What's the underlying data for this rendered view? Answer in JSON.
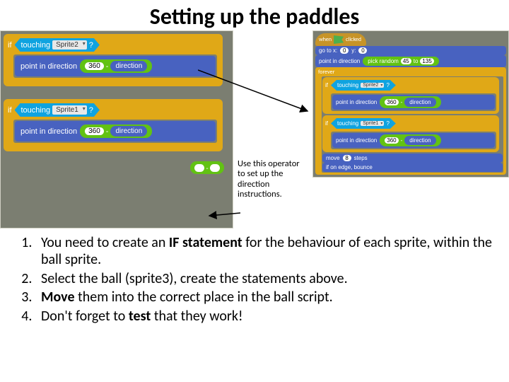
{
  "title": "Setting up the paddles",
  "left_blocks": {
    "if_label": "if",
    "touching_label": "touching",
    "sprite2": "Sprite2",
    "sprite1": "Sprite1",
    "qmark": "?",
    "point_dir": "point in direction",
    "val360": "360",
    "minus": "-",
    "direction": "direction"
  },
  "callout": "Use this operator to set up the direction instructions.",
  "right_blocks": {
    "when": "when",
    "clicked": "clicked",
    "goto": "go to x:",
    "y_label": "y:",
    "zero": "0",
    "point_dir": "point in direction",
    "pick_random": "pick random",
    "v45": "45",
    "to_label": "to",
    "v135": "135",
    "forever": "forever",
    "if_label": "if",
    "touching": "touching",
    "sprite2": "Sprite2",
    "sprite1": "Sprite1",
    "qmark": "?",
    "v360": "360",
    "minus": "-",
    "direction": "direction",
    "move": "move",
    "v8": "8",
    "steps": "steps",
    "edge_bounce": "if on edge, bounce"
  },
  "instructions": {
    "i1a": "You need to create an ",
    "i1b": "IF statement",
    "i1c": " for the behaviour of each sprite, within the ball sprite.",
    "i2": "Select the ball (sprite3), create the statements above.",
    "i3a": "Move",
    "i3b": " them into the correct place in the ball script.",
    "i4a": "Don't forget to ",
    "i4b": "test",
    "i4c": " that they work!"
  }
}
